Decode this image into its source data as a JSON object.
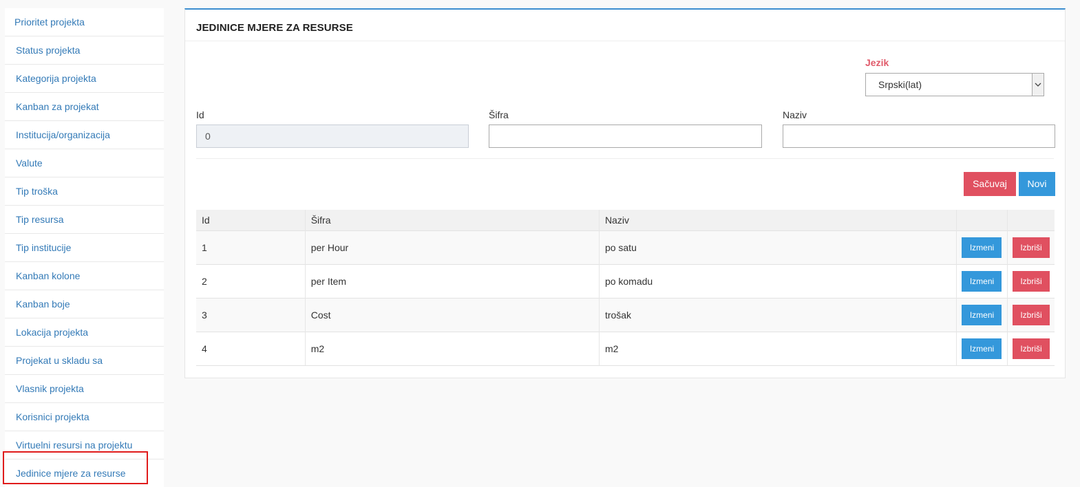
{
  "sidebar": {
    "items": [
      {
        "label": "Prioritet projekta"
      },
      {
        "label": "Status projekta"
      },
      {
        "label": "Kategorija projekta"
      },
      {
        "label": "Kanban za projekat"
      },
      {
        "label": "Institucija/organizacija"
      },
      {
        "label": "Valute"
      },
      {
        "label": "Tip troška"
      },
      {
        "label": "Tip resursa"
      },
      {
        "label": "Tip institucije"
      },
      {
        "label": "Kanban kolone"
      },
      {
        "label": "Kanban boje"
      },
      {
        "label": "Lokacija projekta"
      },
      {
        "label": "Projekat u skladu sa"
      },
      {
        "label": "Vlasnik projekta"
      },
      {
        "label": "Korisnici projekta"
      },
      {
        "label": "Virtuelni resursi na projektu"
      },
      {
        "label": "Jedinice mjere za resurse"
      }
    ]
  },
  "panel": {
    "title": "JEDINICE MJERE ZA RESURSE",
    "language": {
      "label": "Jezik",
      "selected": "Srpski(lat)"
    },
    "form": {
      "id_label": "Id",
      "id_value": "0",
      "sifra_label": "Šifra",
      "sifra_value": "",
      "naziv_label": "Naziv",
      "naziv_value": ""
    },
    "buttons": {
      "save": "Sačuvaj",
      "new": "Novi"
    },
    "table": {
      "headers": [
        "Id",
        "Šifra",
        "Naziv",
        "",
        ""
      ],
      "rows": [
        {
          "id": "1",
          "sifra": "per Hour",
          "naziv": "po satu"
        },
        {
          "id": "2",
          "sifra": "per Item",
          "naziv": "po komadu"
        },
        {
          "id": "3",
          "sifra": "Cost",
          "naziv": "trošak"
        },
        {
          "id": "4",
          "sifra": "m2",
          "naziv": "m2"
        }
      ],
      "edit_label": "Izmeni",
      "delete_label": "Izbriši"
    }
  },
  "colors": {
    "accent": "#3498db",
    "danger": "#e05060",
    "link": "#337ab7",
    "highlight": "#e01b1b"
  }
}
